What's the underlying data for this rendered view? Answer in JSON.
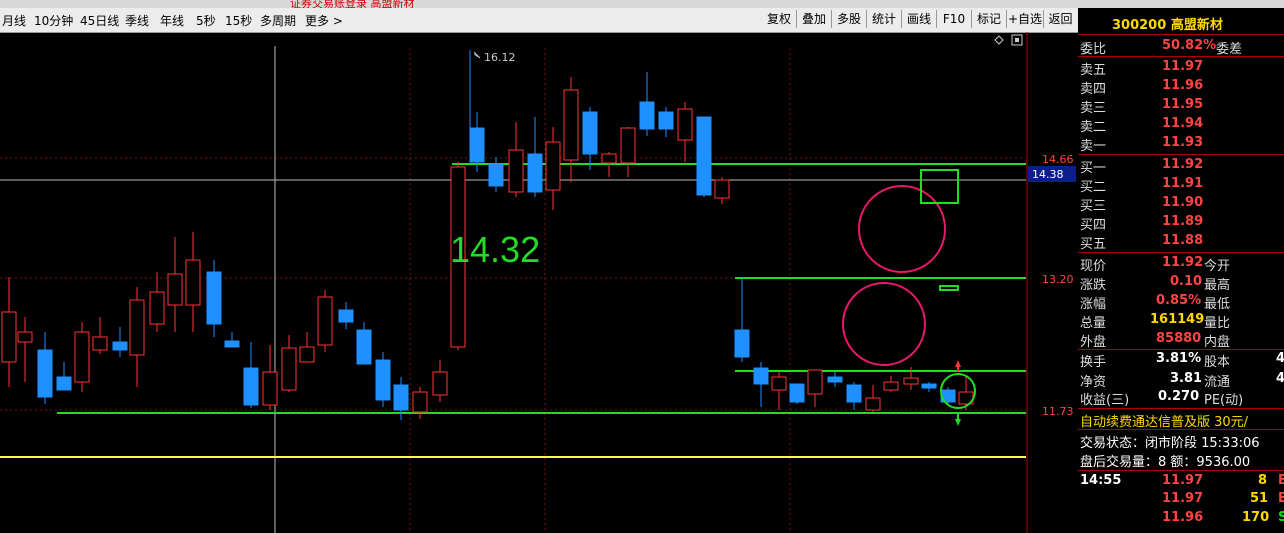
{
  "top_banner": {
    "text": "证券交易账登录  高盟新材"
  },
  "toolbar": {
    "periods": [
      "月线",
      "10分钟",
      "45日线",
      "季线",
      "年线",
      "5秒",
      "15秒",
      "多周期",
      "更多 >"
    ],
    "right_buttons": [
      "复权",
      "叠加",
      "多股",
      "统计",
      "画线",
      "F10",
      "标记",
      "+自选",
      "返回"
    ]
  },
  "chart": {
    "price_labels": {
      "p1466": "14.66",
      "p1438": "14.38",
      "p1320": "13.20",
      "p1173": "11.73"
    },
    "high_label": "16.12",
    "annotation": "14.32",
    "colors": {
      "up": "#ff3333",
      "down": "#1e90ff",
      "green": "#22dd22",
      "magenta": "#e8186c",
      "yellow": "#ffff40",
      "accent": "#0a1e8c"
    }
  },
  "quote": {
    "code": "300200",
    "name": "高盟新材",
    "wei_bi": {
      "label": "委比",
      "value": "50.82%",
      "label2": "委差"
    },
    "sell": [
      {
        "label": "卖五",
        "price": "11.97"
      },
      {
        "label": "卖四",
        "price": "11.96"
      },
      {
        "label": "卖三",
        "price": "11.95"
      },
      {
        "label": "卖二",
        "price": "11.94"
      },
      {
        "label": "卖一",
        "price": "11.93"
      }
    ],
    "buy": [
      {
        "label": "买一",
        "price": "11.92"
      },
      {
        "label": "买二",
        "price": "11.91"
      },
      {
        "label": "买三",
        "price": "11.90"
      },
      {
        "label": "买四",
        "price": "11.89"
      },
      {
        "label": "买五",
        "price": "11.88"
      }
    ],
    "stats": [
      {
        "label": "现价",
        "value": "11.92",
        "label2": "今开"
      },
      {
        "label": "涨跌",
        "value": "0.10",
        "label2": "最高"
      },
      {
        "label": "涨幅",
        "value": "0.85%",
        "label2": "最低"
      },
      {
        "label": "总量",
        "value": "161149",
        "label2": "量比"
      },
      {
        "label": "外盘",
        "value": "85880",
        "label2": "内盘"
      }
    ],
    "stats2": [
      {
        "label": "换手",
        "value": "3.81%",
        "label2": "股本",
        "tail": "4"
      },
      {
        "label": "净资",
        "value": "3.81",
        "label2": "流通",
        "tail": "4"
      },
      {
        "label": "收益(三)",
        "value": "0.270",
        "label2": "PE(动)",
        "tail": ""
      }
    ],
    "ad_text": "自动续费通达信普及版  30元/",
    "trade_state": "交易状态：闭市阶段  15:33:06",
    "after_hours": "盘后交易量：8  额：9536.00",
    "ticks": [
      {
        "time": "14:55",
        "price": "11.97",
        "vol": "8",
        "flag": "B"
      },
      {
        "time": "",
        "price": "11.97",
        "vol": "51",
        "flag": "B"
      },
      {
        "time": "",
        "price": "11.96",
        "vol": "170",
        "flag": "S"
      }
    ]
  }
}
